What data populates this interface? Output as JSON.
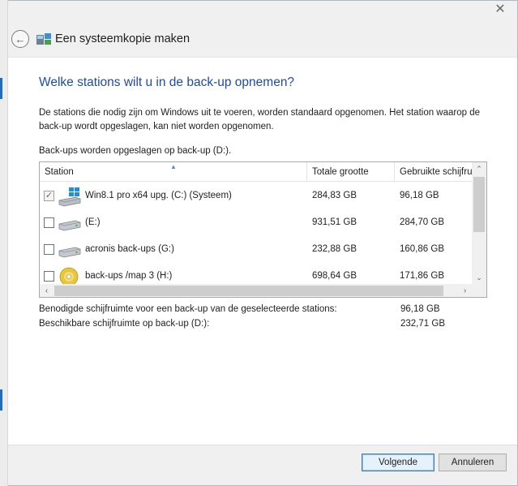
{
  "window": {
    "title": "Een systeemkopie maken",
    "close_glyph": "✕"
  },
  "page": {
    "heading": "Welke stations wilt u in de back-up opnemen?",
    "description": "De stations die nodig zijn om Windows uit te voeren, worden standaard opgenomen. Het station waarop de back-up wordt opgeslagen, kan niet worden opgenomen.",
    "save_location": "Back-ups worden opgeslagen op  back-up (D:)."
  },
  "table": {
    "columns": [
      "Station",
      "Totale grootte",
      "Gebruikte schijfruimte"
    ],
    "rows": [
      {
        "name": "Win8.1 pro x64 upg. (C:) (Systeem)",
        "total": "284,83 GB",
        "used": "96,18 GB",
        "checked": true,
        "icon": "windows-drive-icon"
      },
      {
        "name": "(E:)",
        "total": "931,51 GB",
        "used": "284,70 GB",
        "checked": false,
        "icon": "hard-drive-icon"
      },
      {
        "name": "acronis back-ups (G:)",
        "total": "232,88 GB",
        "used": "160,86 GB",
        "checked": false,
        "icon": "hard-drive-icon"
      },
      {
        "name": "back-ups /map 3 (H:)",
        "total": "698,64 GB",
        "used": "171,86 GB",
        "checked": false,
        "icon": "optical-drive-icon"
      }
    ]
  },
  "summary": {
    "required_label": "Benodigde schijfruimte voor een back-up van de geselecteerde stations:",
    "required_value": "96,18 GB",
    "available_label": "Beschikbare schijfruimte op  back-up (D:):",
    "available_value": "232,71 GB"
  },
  "buttons": {
    "next": "Volgende",
    "cancel": "Annuleren"
  },
  "colors": {
    "heading": "#1e4aa8",
    "windows_blue": "#1c8fe0"
  }
}
